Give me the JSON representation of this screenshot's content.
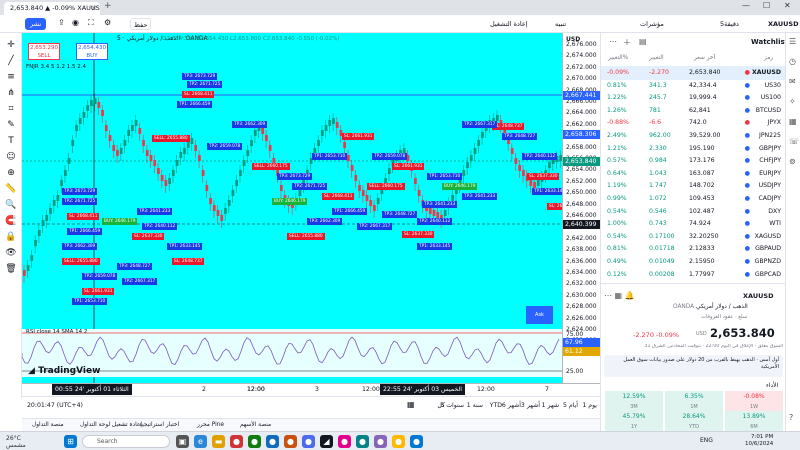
{
  "browser": {
    "tab_title": "2,653.840 ▲ -0.09% XAUUSD",
    "tab_close": "×",
    "new_tab": "+",
    "minimize": "—",
    "maximize": "☐",
    "close": "✕"
  },
  "toolbar": {
    "share": "نشر",
    "publish_icon": "upload-icon",
    "save": "حفظ",
    "replay": "إعادة التشغيل",
    "alert": "تنبيه",
    "indicators": "مؤشرات",
    "interval": "5دقيقة",
    "symbol": "XAUUSD"
  },
  "left_tools": [
    "✛",
    "╱",
    "≡",
    "⋔",
    "⌗",
    "✎",
    "T",
    "☺",
    "⊕",
    "📏",
    "🔍",
    "🧲",
    "🔒",
    "👁",
    "🗑"
  ],
  "chart": {
    "symbol_line": "الذهب / دولار أمريكي · 5 · OANDA",
    "ohlc": "O2,654.390 H2,654.430 L2,653.800 C2,653.840 -0.550 (-0.02%)",
    "sell_price": "2,653.290",
    "sell_label": "SELL",
    "buy_price": "2,654.430",
    "buy_label": "BUY",
    "indicator_label": "FNJR 3.4 5 1.2 1.5 2.4",
    "rsi_label": "RSI close 14 SMA 14 2",
    "bubble_label": "Ask",
    "watermark": "TradingView"
  },
  "trade_labels": [
    {
      "text": "TP3: 2673.729",
      "c": "b"
    },
    {
      "text": "TP2: 2671.725",
      "c": "b"
    },
    {
      "text": "SL: 2668.411",
      "c": "r"
    },
    {
      "text": "TP1: 2666.459",
      "c": "b"
    },
    {
      "text": "TP3: 2662.309",
      "c": "b"
    },
    {
      "text": "SELL: 2655.880",
      "c": "r"
    },
    {
      "text": "TP2: 2659.078",
      "c": "b"
    },
    {
      "text": "SL: 2661.931",
      "c": "r"
    },
    {
      "text": "TP1: 2653.710",
      "c": "b"
    },
    {
      "text": "BUY: 2646.179",
      "c": "g"
    },
    {
      "text": "TP3: 2641.233",
      "c": "b"
    },
    {
      "text": "TP2: 2640.112",
      "c": "b"
    },
    {
      "text": "SL: 2637.330",
      "c": "r"
    },
    {
      "text": "TP1: 2633.145",
      "c": "b"
    },
    {
      "text": "SL: 2648.737",
      "c": "r"
    },
    {
      "text": "TP3: 2648.727",
      "c": "b"
    },
    {
      "text": "TP2: 2667.317",
      "c": "b"
    },
    {
      "text": "SELL: 2660.175",
      "c": "r"
    }
  ],
  "price_axis": {
    "currency": "USD",
    "labels": [
      "2,676.000",
      "2,674.000",
      "2,672.000",
      "2,670.000",
      "2,668.000",
      "2,666.000",
      "2,664.000",
      "2,662.000",
      "2,660.000",
      "2,658.000",
      "2,656.000",
      "2,654.000",
      "2,652.000",
      "2,650.000",
      "2,648.000",
      "2,646.000",
      "2,644.000",
      "2,642.000",
      "2,638.000",
      "2,636.000",
      "2,634.000",
      "2,632.000",
      "2,630.000",
      "2,628.000",
      "2,626.000",
      "2,624.000",
      "2,622.000",
      "2,620.000"
    ],
    "tag_high": "2,667.441",
    "tag_mid": "2,658.306",
    "tag_cur": "2,653.840",
    "tag_low": "2,640.399",
    "rsi_labels": [
      "75.00",
      "25.00"
    ],
    "rsi_tag1": "67.96",
    "rsi_tag2": "61.12"
  },
  "time_axis": {
    "labels": [
      "12:00",
      "2",
      "12:00",
      "3",
      "12:00",
      "12:00",
      "7"
    ],
    "badge_left": "الثلاثاء 01 أكتوبر '24    00:55",
    "badge_right": "الخميس 03 أكتوبر '24    22:55"
  },
  "bottom_bar": {
    "ranges": [
      "يوم 1",
      "أيام 5",
      "1 شهر",
      "3 أشهر",
      "6 أشهر",
      "YTD",
      "1 سنة",
      "5 سنوات",
      "كل"
    ],
    "time": "20:01:47 (UTC+4)",
    "cal_icon": "calendar-icon"
  },
  "bottom_tabs": [
    "منصة التداول",
    "إعادة تشغيل لوحة التداول",
    "اختبار استراتيجية",
    "محرر Pine",
    "منصة الأسهم"
  ],
  "watchlist": {
    "title": "Watchlist",
    "columns": [
      "رمز",
      "آخر سعر",
      "التغيير",
      "التغيير%"
    ],
    "rows": [
      {
        "sym": "XAUUSD",
        "last": "2,653.840",
        "chg": "-2.270",
        "pct": "-0.09%",
        "neg": true,
        "sel": true
      },
      {
        "sym": "US30",
        "last": "42,334.4",
        "chg": "341.3",
        "pct": "0.81%",
        "neg": false
      },
      {
        "sym": "US100",
        "last": "19,999.4",
        "chg": "245.7",
        "pct": "1.22%",
        "neg": false
      },
      {
        "sym": "BTCUSD",
        "last": "62,841",
        "chg": "781",
        "pct": "1.26%",
        "neg": false
      },
      {
        "sym": "JPYX",
        "last": "742.0",
        "chg": "-6.6",
        "pct": "-0.88%",
        "neg": true
      },
      {
        "sym": "JPN225",
        "last": "39,529.00",
        "chg": "962.00",
        "pct": "2.49%",
        "neg": false
      },
      {
        "sym": "GBPJPY",
        "last": "195.190",
        "chg": "2.330",
        "pct": "1.21%",
        "neg": false
      },
      {
        "sym": "CHFJPY",
        "last": "173.176",
        "chg": "0.984",
        "pct": "0.57%",
        "neg": false
      },
      {
        "sym": "EURJPY",
        "last": "163.087",
        "chg": "1.043",
        "pct": "0.64%",
        "neg": false
      },
      {
        "sym": "USDJPY",
        "last": "148.702",
        "chg": "1.747",
        "pct": "1.19%",
        "neg": false
      },
      {
        "sym": "CADJPY",
        "last": "109.453",
        "chg": "1.072",
        "pct": "0.99%",
        "neg": false
      },
      {
        "sym": "DXY",
        "last": "102.487",
        "chg": "0.546",
        "pct": "0.54%",
        "neg": false
      },
      {
        "sym": "WTI",
        "last": "74.924",
        "chg": "0.743",
        "pct": "1.00%",
        "neg": false
      },
      {
        "sym": "XAGUSD",
        "last": "32.20250",
        "chg": "0.17100",
        "pct": "0.54%",
        "neg": false
      },
      {
        "sym": "GBPAUD",
        "last": "2.12833",
        "chg": "0.01718",
        "pct": "0.81%",
        "neg": false
      },
      {
        "sym": "GBPNZD",
        "last": "2.15950",
        "chg": "0.01049",
        "pct": "0.49%",
        "neg": false
      },
      {
        "sym": "GBPCAD",
        "last": "1.77997",
        "chg": "0.00208",
        "pct": "0.12%",
        "neg": false
      }
    ],
    "detail_symbol": "XAUUSD",
    "detail_name": "الذهب / دولار أمريكي",
    "detail_exchange": "OANDA",
    "detail_cat": "سلع · عقود الفروقات",
    "detail_price": "2,653.840",
    "detail_currency": "USD",
    "detail_change": "-2.270 -0.09%",
    "detail_status": "السوق مغلق · الإغلاق في اليوم 22:00 · بتوقيت المحادثين الشرق 31",
    "news": "أول أمس · الذهب يهبط بالقرب من 20 دولار على صدور بيانات سوق العمل الأمريكية",
    "perf_title": "الأداء",
    "perf": [
      {
        "v": "-0.08%",
        "l": "1W",
        "neg": true
      },
      {
        "v": "6.35%",
        "l": "1M",
        "neg": false
      },
      {
        "v": "12.59%",
        "l": "3M",
        "neg": false
      },
      {
        "v": "13.89%",
        "l": "6M",
        "neg": false
      },
      {
        "v": "28.64%",
        "l": "YTD",
        "neg": false
      },
      {
        "v": "45.79%",
        "l": "1Y",
        "neg": false
      }
    ]
  },
  "taskbar": {
    "weather_temp": "26°C",
    "weather_desc": "مشمس",
    "search": "Search",
    "clock": "7:01 PM",
    "date": "10/6/2024",
    "lang": "ENG"
  }
}
